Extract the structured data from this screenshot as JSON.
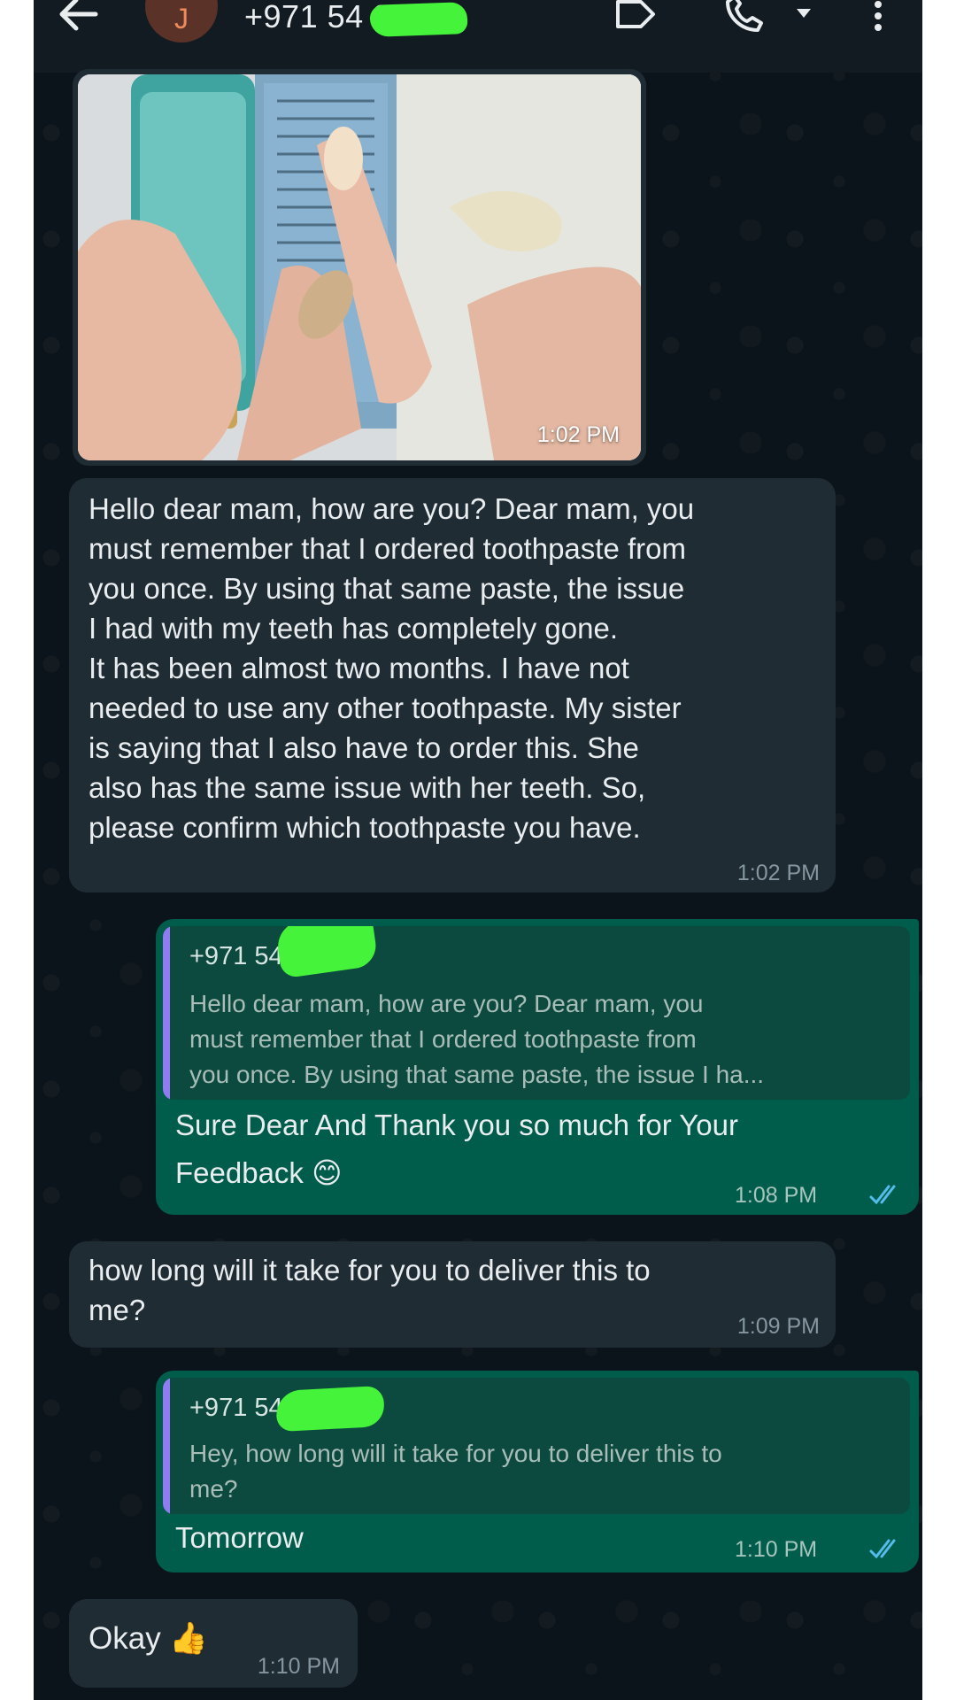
{
  "header": {
    "back_icon": "arrow-left-icon",
    "avatar_letter": "J",
    "contact_name": "+971 54          382",
    "icons": [
      "label-icon",
      "phone-icon",
      "chevron-down-icon",
      "more-vertical-icon"
    ]
  },
  "messages": {
    "photo": {
      "time": "1:02 PM",
      "alt": "photo of toothpaste bottle and box held in hand"
    },
    "m1": {
      "lines": [
        "Hello dear mam, how are you? Dear mam, you",
        "must remember that I ordered toothpaste from",
        "you once. By using that same paste, the issue",
        "I had with my teeth has completely gone.",
        "It has been almost two months. I have not",
        "needed to use any other toothpaste. My sister",
        "is saying that I also have to order this. She",
        "also has the same issue with her teeth. So,",
        "please confirm which toothpaste you have."
      ],
      "time": "1:02 PM"
    },
    "r1": {
      "quote_author": "+971 54          382",
      "quote_lines": [
        "Hello dear mam, how are you? Dear mam, you",
        "must remember that I ordered toothpaste from",
        "you once. By using that same paste, the issue I ha..."
      ],
      "lines": [
        "Sure Dear And Thank you so much for Your",
        "Feedback 😊"
      ],
      "time": "1:08 PM"
    },
    "m2": {
      "lines": [
        "how long will it take for you to deliver this to",
        "me?"
      ],
      "time": "1:09 PM"
    },
    "r2": {
      "quote_author": "+971 54          382",
      "quote_lines": [
        "Hey, how long will it take for you to deliver this to",
        "me?"
      ],
      "text": "Tomorrow",
      "time": "1:10 PM"
    },
    "m3": {
      "text": "Okay 👍",
      "time": "1:10 PM"
    }
  },
  "colors": {
    "chat_bg": "#0b141a",
    "incoming_bubble": "#1f2c34",
    "outgoing_bubble": "#005c4b",
    "read_ticks": "#53bdeb",
    "redaction": "#45f33b"
  }
}
